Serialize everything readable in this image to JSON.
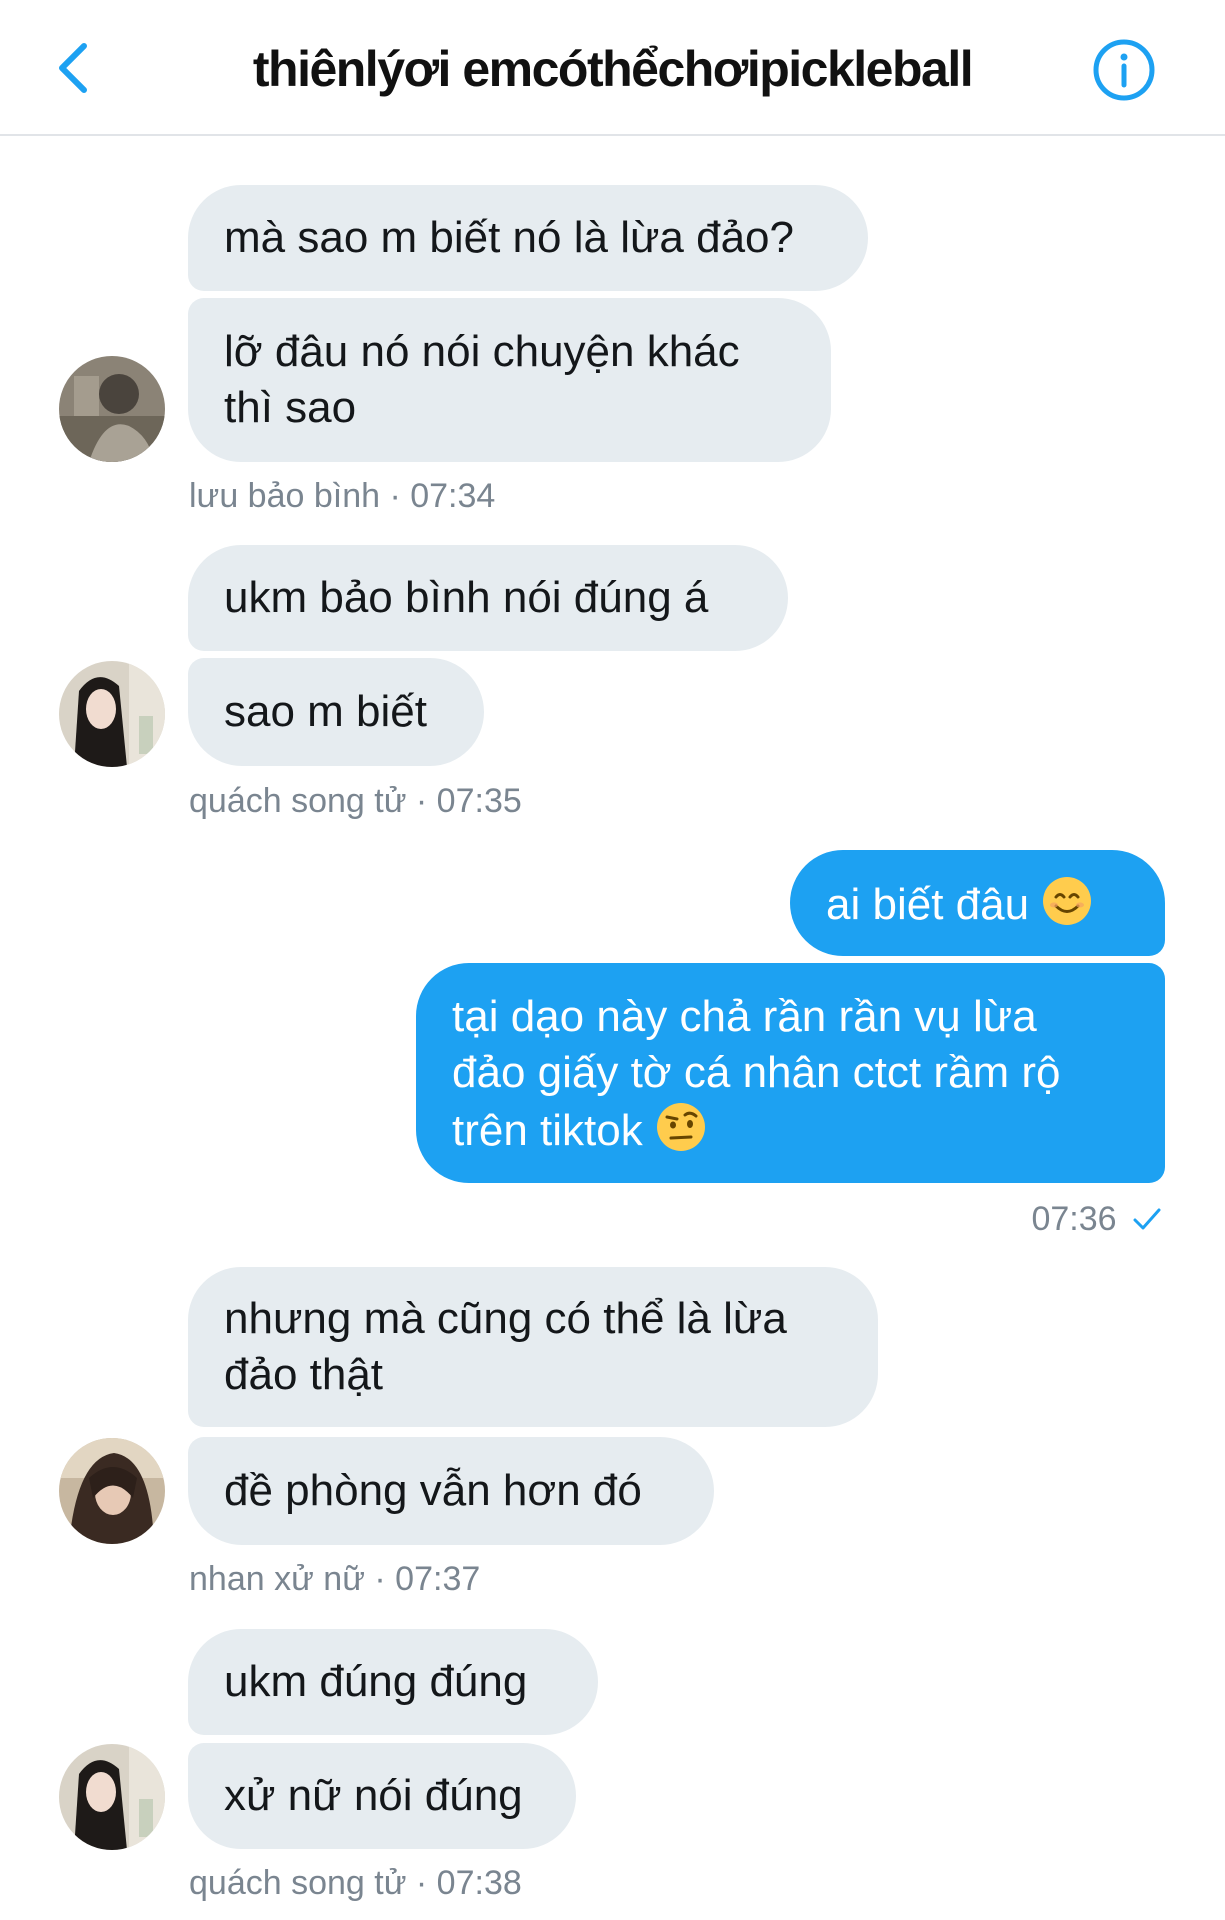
{
  "header": {
    "title": "thiênlýơi emcóthểchơipickleball",
    "back_icon": "chevron-left-icon",
    "info_icon": "info-circle-icon",
    "accent": "#1da1f2"
  },
  "messages": {
    "g1": {
      "m1": "mà sao m biết nó là lừa đảo?",
      "m2": "lỡ đâu nó nói chuyện khác\nthì sao",
      "meta": "lưu bảo bình · 07:34"
    },
    "g2": {
      "m1": "ukm bảo bình nói đúng á",
      "m2": "sao m biết",
      "meta": "quách song tử · 07:35"
    },
    "g3": {
      "m1": "ai biết đâu",
      "m1_emoji": "smiling-face-emoji",
      "m2": "tại dạo này chả rần rần vụ lừa\nđảo giấy tờ cá nhân ctct rầm rộ\ntrên tiktok",
      "m2_emoji": "raised-eyebrow-face-emoji",
      "time": "07:36",
      "status_icon": "checkmark-icon"
    },
    "g4": {
      "m1": "nhưng mà cũng có thể là lừa\nđảo thật",
      "m2": "đề phòng vẫn hơn đó",
      "meta": "nhan xử nữ · 07:37"
    },
    "g5": {
      "m1": "ukm đúng đúng",
      "m2": "xử nữ nói đúng",
      "meta": "quách song tử · 07:38"
    }
  },
  "colors": {
    "incoming_bubble": "#e6ecf0",
    "outgoing_bubble": "#1da1f2",
    "meta_text": "#7a8590"
  }
}
